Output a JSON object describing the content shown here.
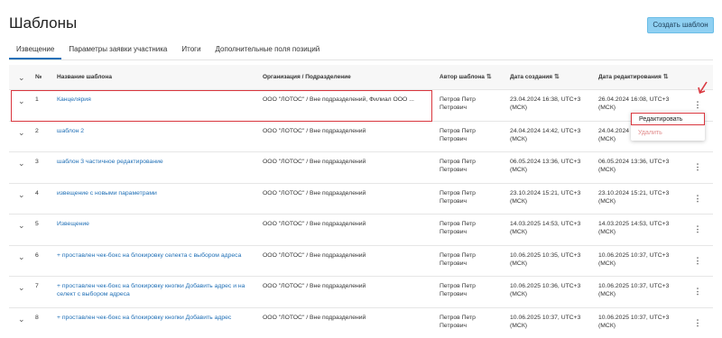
{
  "page": {
    "title": "Шаблоны",
    "create_button": "Создать шаблон"
  },
  "tabs": [
    {
      "label": "Извещение",
      "active": true
    },
    {
      "label": "Параметры заявки участника"
    },
    {
      "label": "Итоги"
    },
    {
      "label": "Дополнительные поля позиций"
    }
  ],
  "table": {
    "headers": {
      "num": "№",
      "name": "Название шаблона",
      "org": "Организация / Подразделение",
      "author": "Автор шаблона",
      "created": "Дата создания",
      "edited": "Дата редактирования"
    },
    "rows": [
      {
        "num": "1",
        "name": "Канцелярия",
        "org": "ООО \"ЛОТОС\" / Вне подразделений, Филиал ООО ...",
        "author": "Петров Петр Петрович",
        "created": "23.04.2024 16:38, UTC+3 (МСК)",
        "edited": "26.04.2024 16:08, UTC+3 (МСК)"
      },
      {
        "num": "2",
        "name": "шаблон 2",
        "org": "ООО \"ЛОТОС\" / Вне подразделений",
        "author": "Петров Петр Петрович",
        "created": "24.04.2024 14:42, UTC+3 (МСК)",
        "edited": "24.04.2024 14:42, UTC+3 (МСК)"
      },
      {
        "num": "3",
        "name": "шаблон 3 частичное редактирование",
        "org": "ООО \"ЛОТОС\" / Вне подразделений",
        "author": "Петров Петр Петрович",
        "created": "06.05.2024 13:36, UTC+3 (МСК)",
        "edited": "06.05.2024 13:36, UTC+3 (МСК)"
      },
      {
        "num": "4",
        "name": "извещение с новыми параметрами",
        "org": "ООО \"ЛОТОС\" / Вне подразделений",
        "author": "Петров Петр Петрович",
        "created": "23.10.2024 15:21, UTC+3 (МСК)",
        "edited": "23.10.2024 15:21, UTC+3 (МСК)"
      },
      {
        "num": "5",
        "name": "Извещение",
        "org": "ООО \"ЛОТОС\" / Вне подразделений",
        "author": "Петров Петр Петрович",
        "created": "14.03.2025 14:53, UTC+3 (МСК)",
        "edited": "14.03.2025 14:53, UTC+3 (МСК)"
      },
      {
        "num": "6",
        "name": "+ проставлен чек-бокс на блокировку селекта с выбором адреса",
        "org": "ООО \"ЛОТОС\" / Вне подразделений",
        "author": "Петров Петр Петрович",
        "created": "10.06.2025 10:35, UTC+3 (МСК)",
        "edited": "10.06.2025 10:37, UTC+3 (МСК)"
      },
      {
        "num": "7",
        "name": "+ проставлен чек-бокс на блокировку кнопки Добавить адрес и на селект с выбором адреса",
        "org": "ООО \"ЛОТОС\" / Вне подразделений",
        "author": "Петров Петр Петрович",
        "created": "10.06.2025 10:36, UTC+3 (МСК)",
        "edited": "10.06.2025 10:37, UTC+3 (МСК)"
      },
      {
        "num": "8",
        "name": "+ проставлен чек-бокс на блокировку кнопки Добавить адрес",
        "org": "ООО \"ЛОТОС\" / Вне подразделений",
        "author": "Петров Петр Петрович",
        "created": "10.06.2025 10:37, UTC+3 (МСК)",
        "edited": "10.06.2025 10:37, UTC+3 (МСК)"
      }
    ]
  },
  "context_menu": {
    "edit": "Редактировать",
    "delete": "Удалить"
  },
  "colors": {
    "accent": "#1f6fb6",
    "create_button": "#8fd0f2",
    "highlight": "#d9363e"
  }
}
